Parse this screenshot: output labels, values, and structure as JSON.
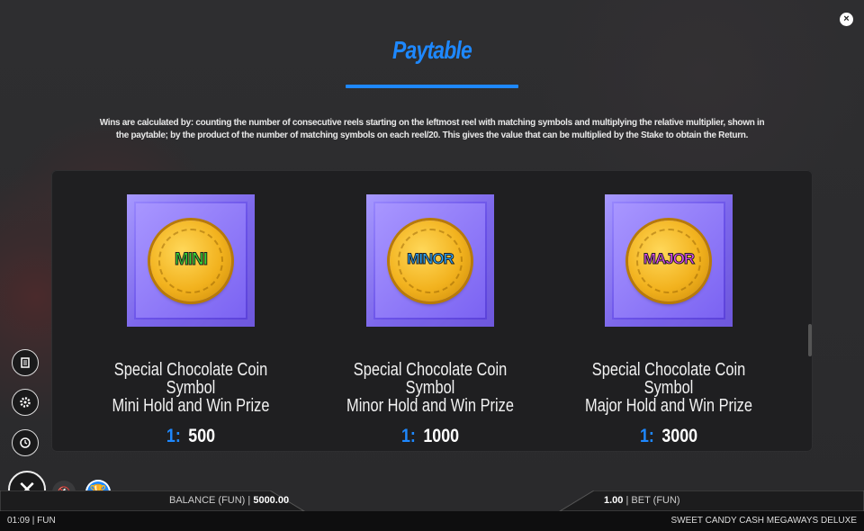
{
  "header": {
    "title": "Paytable",
    "description": "Wins are calculated by: counting the number of consecutive reels starting on the leftmost reel with matching symbols and multiplying the relative multiplier, shown in the paytable; by the product of the number of matching symbols on each reel/20. This gives the value that can be multiplied by the Stake to obtain the Return."
  },
  "colors": {
    "accent": "#1e88ff",
    "tile": "#7b63f2",
    "coin": "#f2b21e",
    "mini": "#35d534",
    "minor": "#2aa8ff",
    "major": "#e94cff"
  },
  "symbols": [
    {
      "coin_label": "MINI",
      "line1": "Special Chocolate Coin Symbol",
      "line2": "Mini Hold and Win Prize",
      "key": "1:",
      "value": "500"
    },
    {
      "coin_label": "MINOR",
      "line1": "Special Chocolate Coin Symbol",
      "line2": "Minor Hold and Win Prize",
      "key": "1:",
      "value": "1000"
    },
    {
      "coin_label": "MAJOR",
      "line1": "Special Chocolate Coin Symbol",
      "line2": "Major Hold and Win Prize",
      "key": "1:",
      "value": "3000"
    }
  ],
  "side_icons": [
    "paytable-icon",
    "settings-icon",
    "history-icon"
  ],
  "bottom": {
    "balance_label": "BALANCE (FUN)",
    "balance_sep": "|",
    "balance_value": "5000.00",
    "bet_value": "1.00",
    "bet_sep": "|",
    "bet_label": "BET  (FUN)",
    "clock": "01:09 | FUN",
    "game_name": "SWEET CANDY CASH MEGAWAYS DELUXE"
  },
  "icons": {
    "close_top": "×",
    "big_close": "✕",
    "sound": "🔇",
    "trophy": "🏆"
  }
}
